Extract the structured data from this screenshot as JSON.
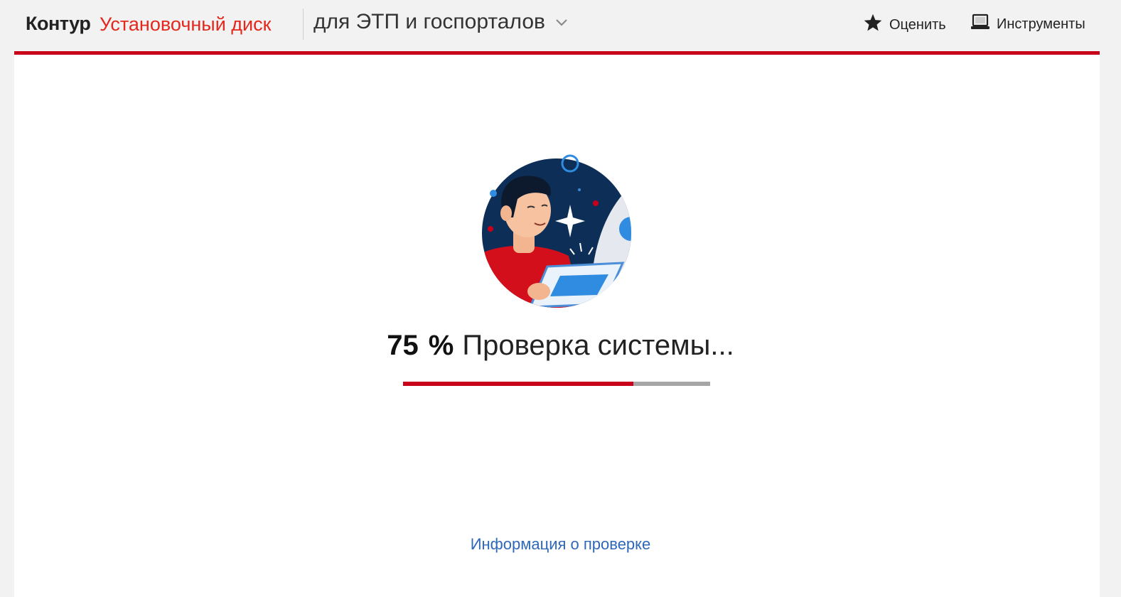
{
  "header": {
    "brand": "Контур",
    "product": "Установочный диск",
    "variant_label": "для ЭТП и госпорталов",
    "nav": {
      "rate_label": "Оценить",
      "tools_label": "Инструменты"
    }
  },
  "icons": {
    "variant_dropdown": "chevron-down-icon",
    "rate": "star-icon",
    "tools": "laptop-icon"
  },
  "colors": {
    "brand_red": "#e3281e",
    "accent_red": "#c9001a",
    "link_blue": "#2f68b9",
    "progress_track": "#a6a6a6"
  },
  "progress": {
    "percent": "75",
    "percent_sign": "%",
    "fraction": 0.75,
    "status_text": "Проверка системы..."
  },
  "footer": {
    "info_link": "Информация о проверке"
  }
}
